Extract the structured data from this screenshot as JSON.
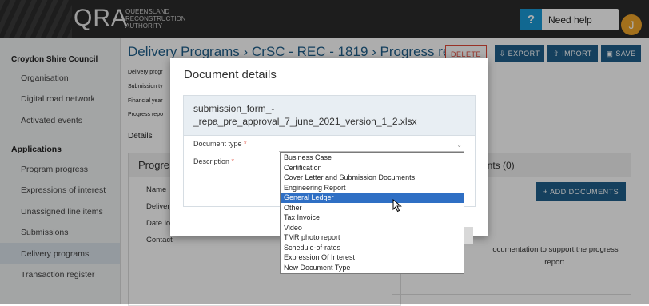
{
  "header": {
    "logo_main": "QRA",
    "logo_sub": [
      "QUEENSLAND",
      "RECONSTRUCTION",
      "AUTHORITY"
    ],
    "help_icon": "?",
    "help_label": "Need help",
    "avatar_initial": "J"
  },
  "sidebar": {
    "council": "Croydon Shire Council",
    "items": [
      "Organisation",
      "Digital road network",
      "Activated events"
    ],
    "section": "Applications",
    "app_items": [
      "Program progress",
      "Expressions of interest",
      "Unassigned line items",
      "Submissions",
      "Delivery programs",
      "Transaction register"
    ],
    "active": "Delivery programs"
  },
  "main": {
    "breadcrumb": "Delivery Programs › CrSC - REC - 1819 › Progress rep...",
    "buttons": {
      "delete": "DELETE",
      "export": "EXPORT",
      "import": "IMPORT",
      "save": "SAVE"
    },
    "meta_labels": [
      "Delivery progr",
      "Submission ty",
      "Financial year",
      "Progress repo"
    ],
    "tab": "Details",
    "panel_title": "Progre",
    "panel_labels": [
      "Name",
      "Delivery p",
      "Date lodg",
      "Contact"
    ],
    "docs_title": "ents (0)",
    "add_documents": "+ ADD DOCUMENTS",
    "docs_note": "ocumentation to support the progress report."
  },
  "modal": {
    "title": "Document details",
    "filename": "submission_form_-_repa_pre_approval_7_june_2021_version_1_2.xlsx",
    "document_type_label": "Document type",
    "description_label": "Description",
    "required_mark": "*"
  },
  "dropdown": {
    "options": [
      "Business Case",
      "Certification",
      "Cover Letter and Submission Documents",
      "Engineering Report",
      "General Ledger",
      "Other",
      "Tax Invoice",
      "Video",
      "TMR photo report",
      "Schedule-of-rates",
      "Expression Of Interest",
      "New Document Type"
    ],
    "highlighted": "General Ledger"
  },
  "colors": {
    "brand_blue": "#1f5f8b",
    "help_blue": "#1a9ad6",
    "delete_red": "#e04a3a",
    "selection_blue": "#2f6fc4",
    "avatar_orange": "#f0a52a"
  }
}
